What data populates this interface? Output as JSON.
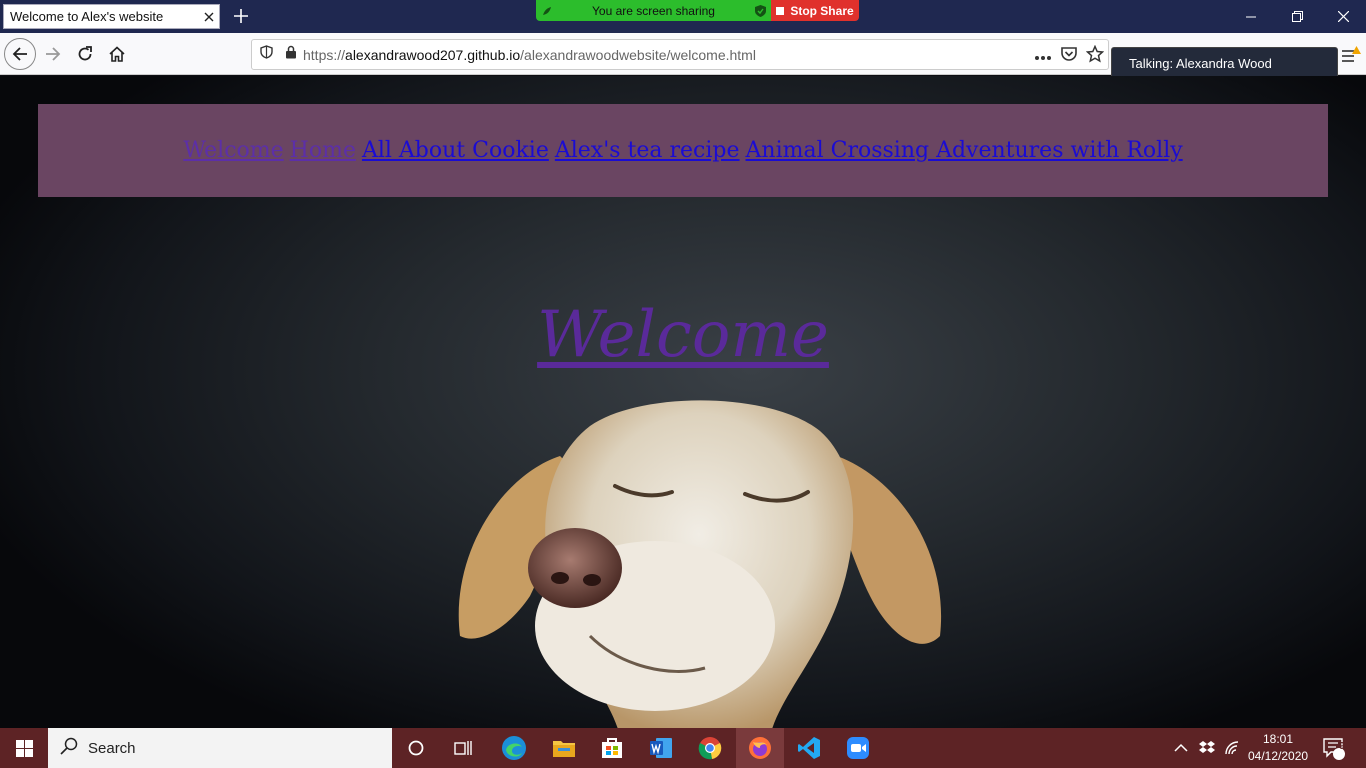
{
  "browser": {
    "tab_title": "Welcome to Alex's website",
    "url_prefix": "https://",
    "url_host": "alexandrawood207.github.io",
    "url_path": "/alexandrawoodwebsite/welcome.html"
  },
  "zoom": {
    "sharing_label": "You are screen sharing",
    "stop_share_label": "Stop Share",
    "talking_label": "Talking: Alexandra Wood"
  },
  "site": {
    "nav_links": [
      {
        "label": "Welcome",
        "state": "visited"
      },
      {
        "label": "Home",
        "state": "visited"
      },
      {
        "label": "All About Cookie",
        "state": "unvisited"
      },
      {
        "label": "Alex's tea recipe",
        "state": "unvisited"
      },
      {
        "label": "Animal Crossing Adventures with Rolly",
        "state": "unvisited"
      }
    ],
    "heading": "Welcome",
    "nav_bg": "#6a4562",
    "visited_color": "#5c2fa8",
    "link_color": "#1a0bd4"
  },
  "taskbar": {
    "search_placeholder": "Search",
    "time": "18:01",
    "date": "04/12/2020",
    "notification_count": "9",
    "pinned_icons": [
      "cortana-icon",
      "task-view-icon",
      "edge-icon",
      "file-explorer-icon",
      "store-icon",
      "word-icon",
      "chrome-icon",
      "firefox-icon",
      "vscode-icon",
      "zoom-icon"
    ]
  }
}
